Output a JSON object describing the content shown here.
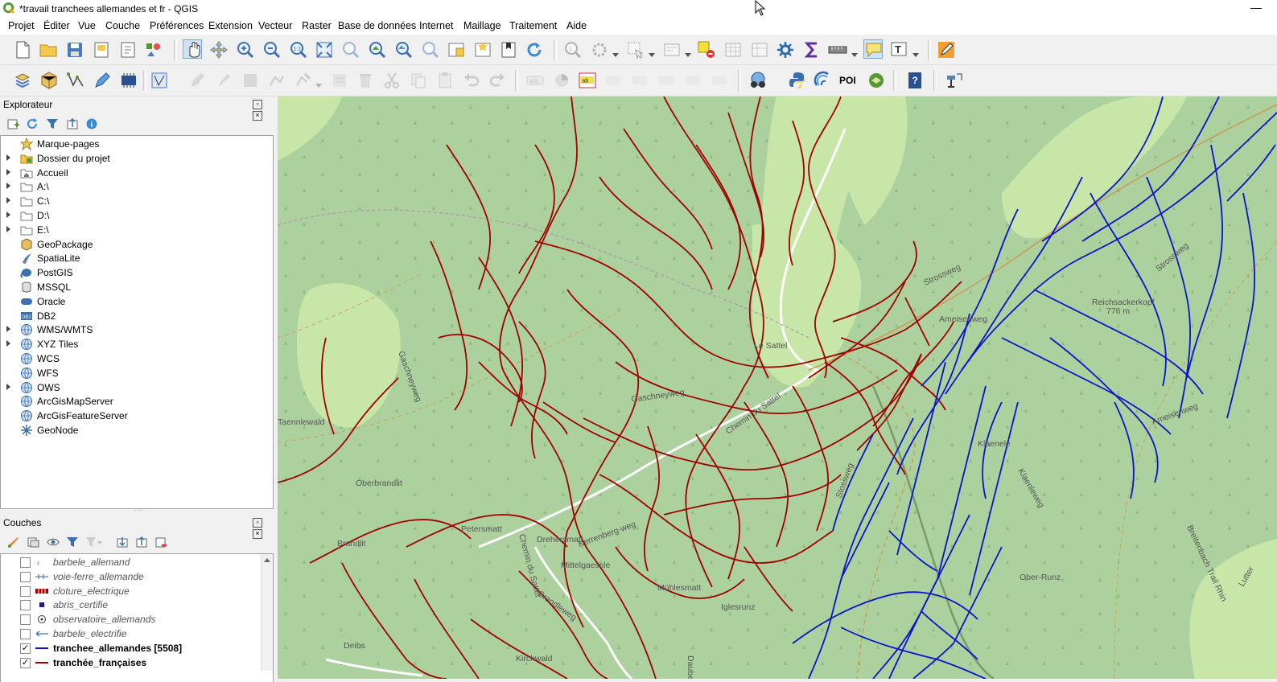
{
  "window": {
    "title": "*travail tranchees allemandes et fr - QGIS",
    "minimize_glyph": "—"
  },
  "menu": [
    "Projet",
    "Éditer",
    "Vue",
    "Couche",
    "Préférences",
    "Extension",
    "Vecteur",
    "Raster",
    "Base de données",
    "Internet",
    "Maillage",
    "Traitement",
    "Aide"
  ],
  "toolbar_text": {
    "poi_label": "POI"
  },
  "browser": {
    "title": "Explorateur",
    "items": [
      {
        "label": "Marque-pages",
        "icon": "star-icon",
        "expandable": false
      },
      {
        "label": "Dossier du projet",
        "icon": "project-folder-icon",
        "expandable": true
      },
      {
        "label": "Accueil",
        "icon": "home-folder-icon",
        "expandable": true
      },
      {
        "label": "A:\\",
        "icon": "drive-folder-icon",
        "expandable": true
      },
      {
        "label": "C:\\",
        "icon": "drive-folder-icon",
        "expandable": true
      },
      {
        "label": "D:\\",
        "icon": "drive-folder-icon",
        "expandable": true
      },
      {
        "label": "E:\\",
        "icon": "drive-folder-icon",
        "expandable": true
      },
      {
        "label": "GeoPackage",
        "icon": "geopackage-icon",
        "expandable": false
      },
      {
        "label": "SpatiaLite",
        "icon": "spatialite-icon",
        "expandable": false
      },
      {
        "label": "PostGIS",
        "icon": "postgis-elephant-icon",
        "expandable": false
      },
      {
        "label": "MSSQL",
        "icon": "mssql-icon",
        "expandable": false
      },
      {
        "label": "Oracle",
        "icon": "oracle-icon",
        "expandable": false
      },
      {
        "label": "DB2",
        "icon": "db2-icon",
        "expandable": false
      },
      {
        "label": "WMS/WMTS",
        "icon": "globe-icon",
        "expandable": true
      },
      {
        "label": "XYZ Tiles",
        "icon": "globe-icon",
        "expandable": true
      },
      {
        "label": "WCS",
        "icon": "globe-icon",
        "expandable": false
      },
      {
        "label": "WFS",
        "icon": "globe-icon",
        "expandable": false
      },
      {
        "label": "OWS",
        "icon": "globe-icon",
        "expandable": true
      },
      {
        "label": "ArcGisMapServer",
        "icon": "globe-icon",
        "expandable": false
      },
      {
        "label": "ArcGisFeatureServer",
        "icon": "globe-icon",
        "expandable": false
      },
      {
        "label": "GeoNode",
        "icon": "geonode-icon",
        "expandable": false
      }
    ]
  },
  "layers_panel": {
    "title": "Couches",
    "layers": [
      {
        "name": "barbele_allemand",
        "checked": false,
        "symbol": "barbed-wire-symbol"
      },
      {
        "name": "voie-ferre_allemande",
        "checked": false,
        "symbol": "railway-symbol"
      },
      {
        "name": "cloture_electrique",
        "checked": false,
        "symbol": "fence-symbol"
      },
      {
        "name": "abris_certifie",
        "checked": false,
        "symbol": "square-point-symbol"
      },
      {
        "name": "observatoire_allemands",
        "checked": false,
        "symbol": "circle-point-symbol"
      },
      {
        "name": "barbele_electrifie",
        "checked": false,
        "symbol": "arrow-line-symbol"
      },
      {
        "name": "tranchee_allemandes [5508]",
        "checked": true,
        "symbol": "blue-line-symbol"
      },
      {
        "name": "tranchée_françaises",
        "checked": true,
        "symbol": "red-line-symbol"
      }
    ]
  },
  "map_labels": [
    "Taennlewald",
    "Gaschneyweg",
    "Gaschneyweg",
    "Le Sattel",
    "Chemin du Sattel",
    "Oberbrandlit",
    "Petersmatt",
    "Drehersmatt",
    "Kerrenberg-weg",
    "Chemin du Sattel",
    "Mittelgaessle",
    "Brandlit",
    "Brandleweg",
    "Mühlesmatt",
    "Iglesrunz",
    "Deibs",
    "Kirchwald",
    "Dauben",
    "Klaenele",
    "Ober-Runz",
    "Reichsackerkopf",
    "776 m",
    "Ameisenweg",
    "Ameisenweg",
    "Strossweg",
    "Strossweg",
    "Klaenleweg",
    "Stossweg",
    "Breitenbach Trail Rhin",
    "Lutter"
  ],
  "colors": {
    "french_trench": "#a00000",
    "german_trench": "#0a14c8",
    "map_bg": "#add19e",
    "meadow": "#c8e6a8"
  }
}
